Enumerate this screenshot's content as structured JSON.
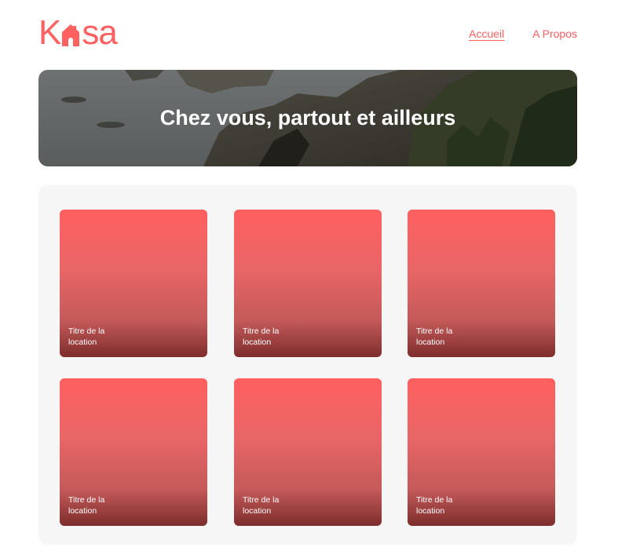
{
  "brand": {
    "logo_left": "K",
    "logo_right": "sa",
    "accent_color": "#FF6060"
  },
  "nav": {
    "items": [
      {
        "label": "Accueil",
        "active": true
      },
      {
        "label": "A Propos",
        "active": false
      }
    ]
  },
  "banner": {
    "title": "Chez vous, partout et ailleurs"
  },
  "gallery": {
    "cards": [
      {
        "title": "Titre de la location"
      },
      {
        "title": "Titre de la location"
      },
      {
        "title": "Titre de la location"
      },
      {
        "title": "Titre de la location"
      },
      {
        "title": "Titre de la location"
      },
      {
        "title": "Titre de la location"
      }
    ]
  }
}
